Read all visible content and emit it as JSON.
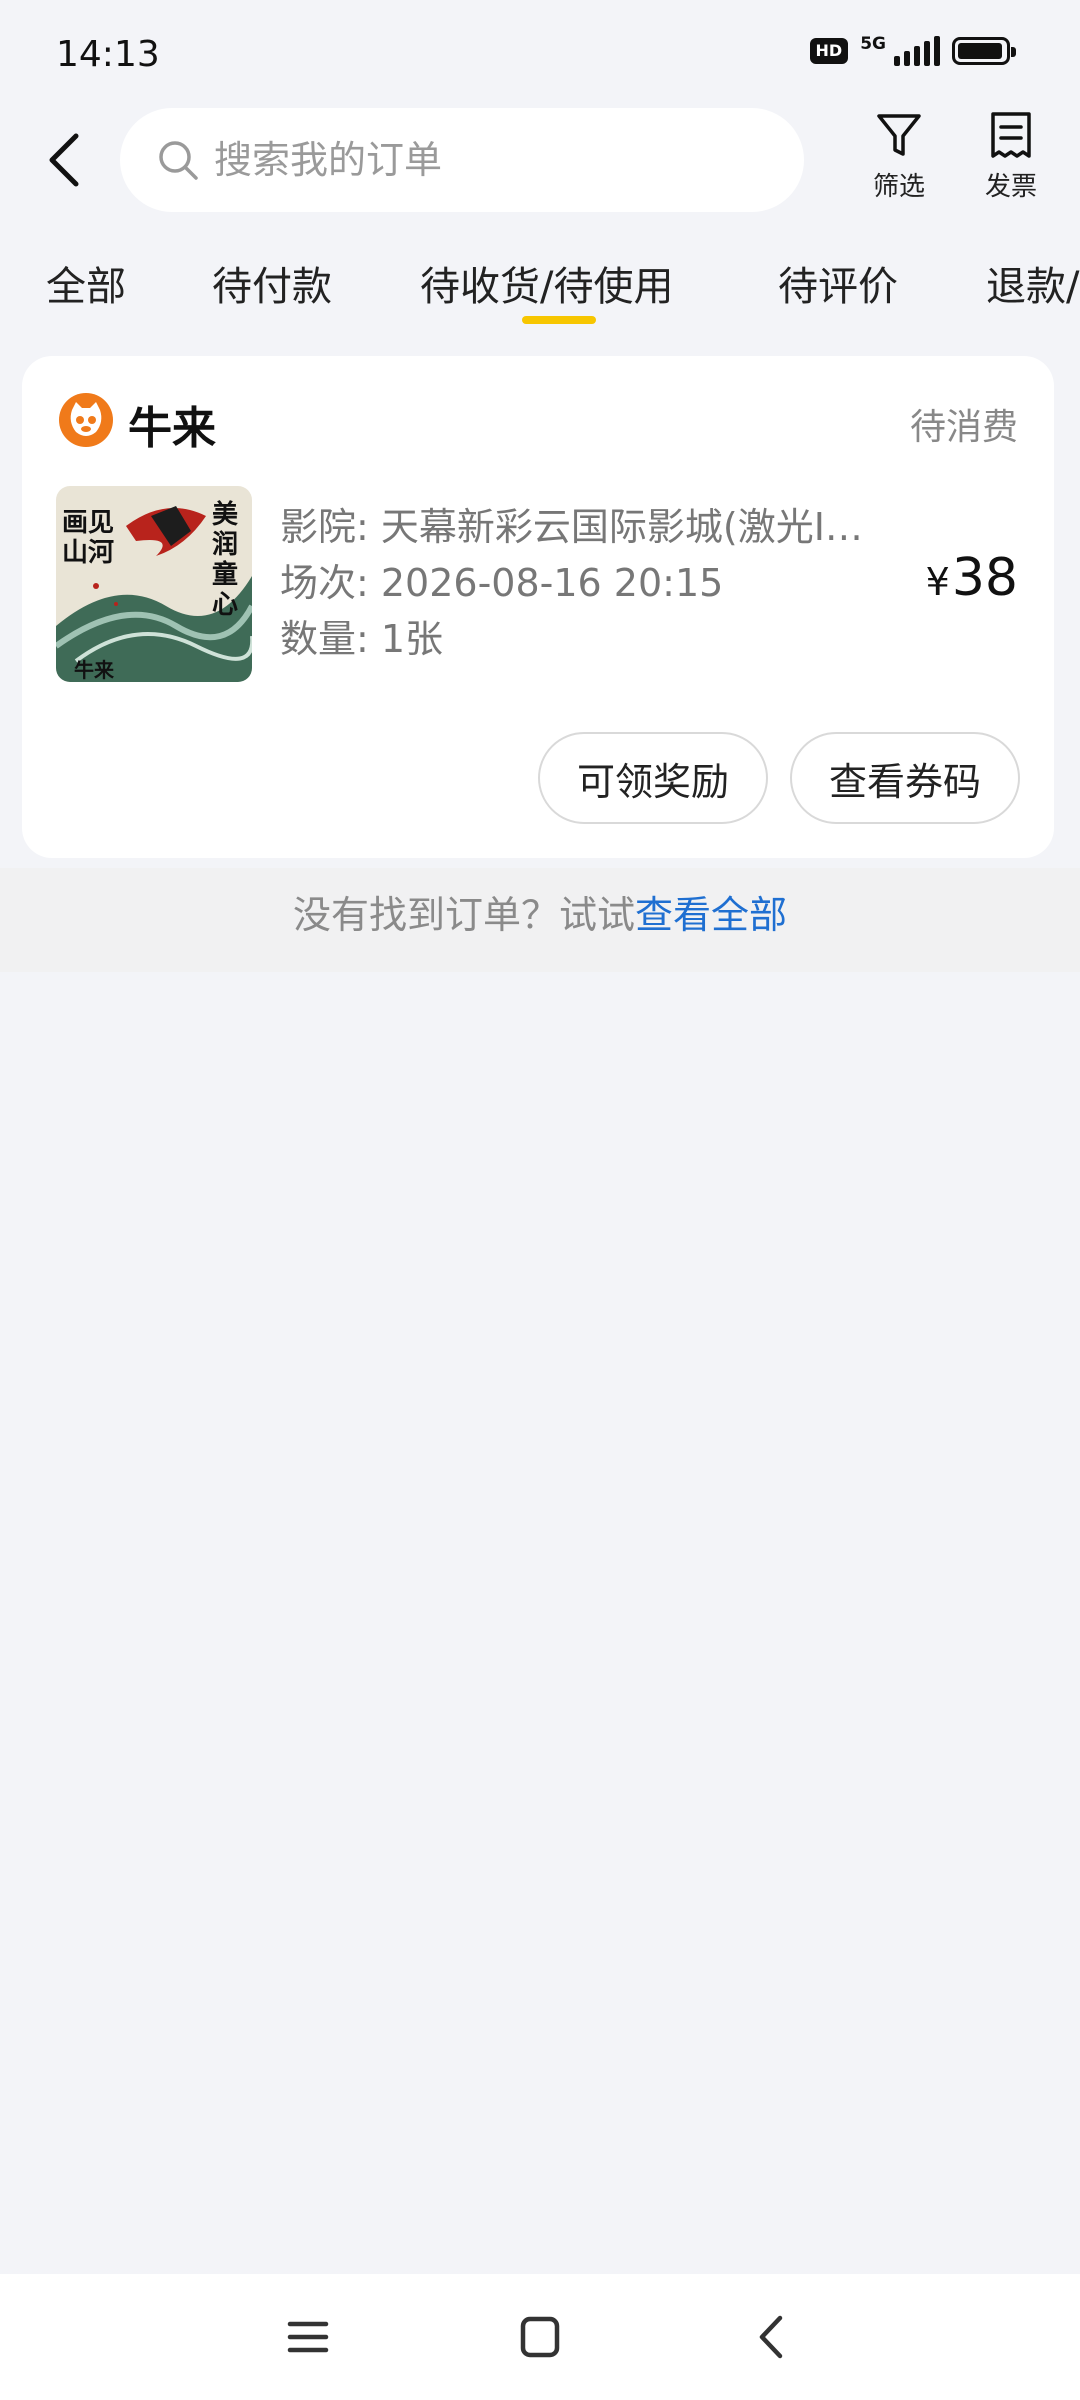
{
  "status_bar": {
    "time": "14:13",
    "hd_badge": "HD",
    "network": "5G",
    "battery_level": 0.95
  },
  "search": {
    "placeholder": "搜索我的订单",
    "filter_label": "筛选",
    "invoice_label": "发票"
  },
  "tabs": [
    {
      "label": "全部",
      "active": false
    },
    {
      "label": "待付款",
      "active": false
    },
    {
      "label": "待收货/待使用",
      "active": true
    },
    {
      "label": "待评价",
      "active": false
    },
    {
      "label": "退款/售后",
      "active": false
    }
  ],
  "order": {
    "shop_name": "牛来",
    "status": "待消费",
    "poster_text": [
      "美润童心",
      "画见山河",
      "牛来"
    ],
    "cinema": "影院: 天幕新彩云国际影城(激光IMAX店)",
    "session": "场次: 2026-08-16 20:15",
    "quantity": "数量: 1张",
    "price_symbol": "¥",
    "price": "38",
    "reward_button": "可领奖励",
    "coupon_button": "查看券码"
  },
  "hint": {
    "text": "没有找到订单？试试",
    "link": "查看全部"
  },
  "colors": {
    "accent_underline": "#f7c600",
    "link": "#1f6fd1",
    "logo_orange": "#f07a1a"
  },
  "icons": {
    "back": "chevron-left-icon",
    "search": "search-icon",
    "filter": "filter-funnel-icon",
    "invoice": "receipt-icon",
    "nav_menu": "menu-icon",
    "nav_home": "home-square-icon",
    "nav_back": "back-triangle-icon"
  }
}
